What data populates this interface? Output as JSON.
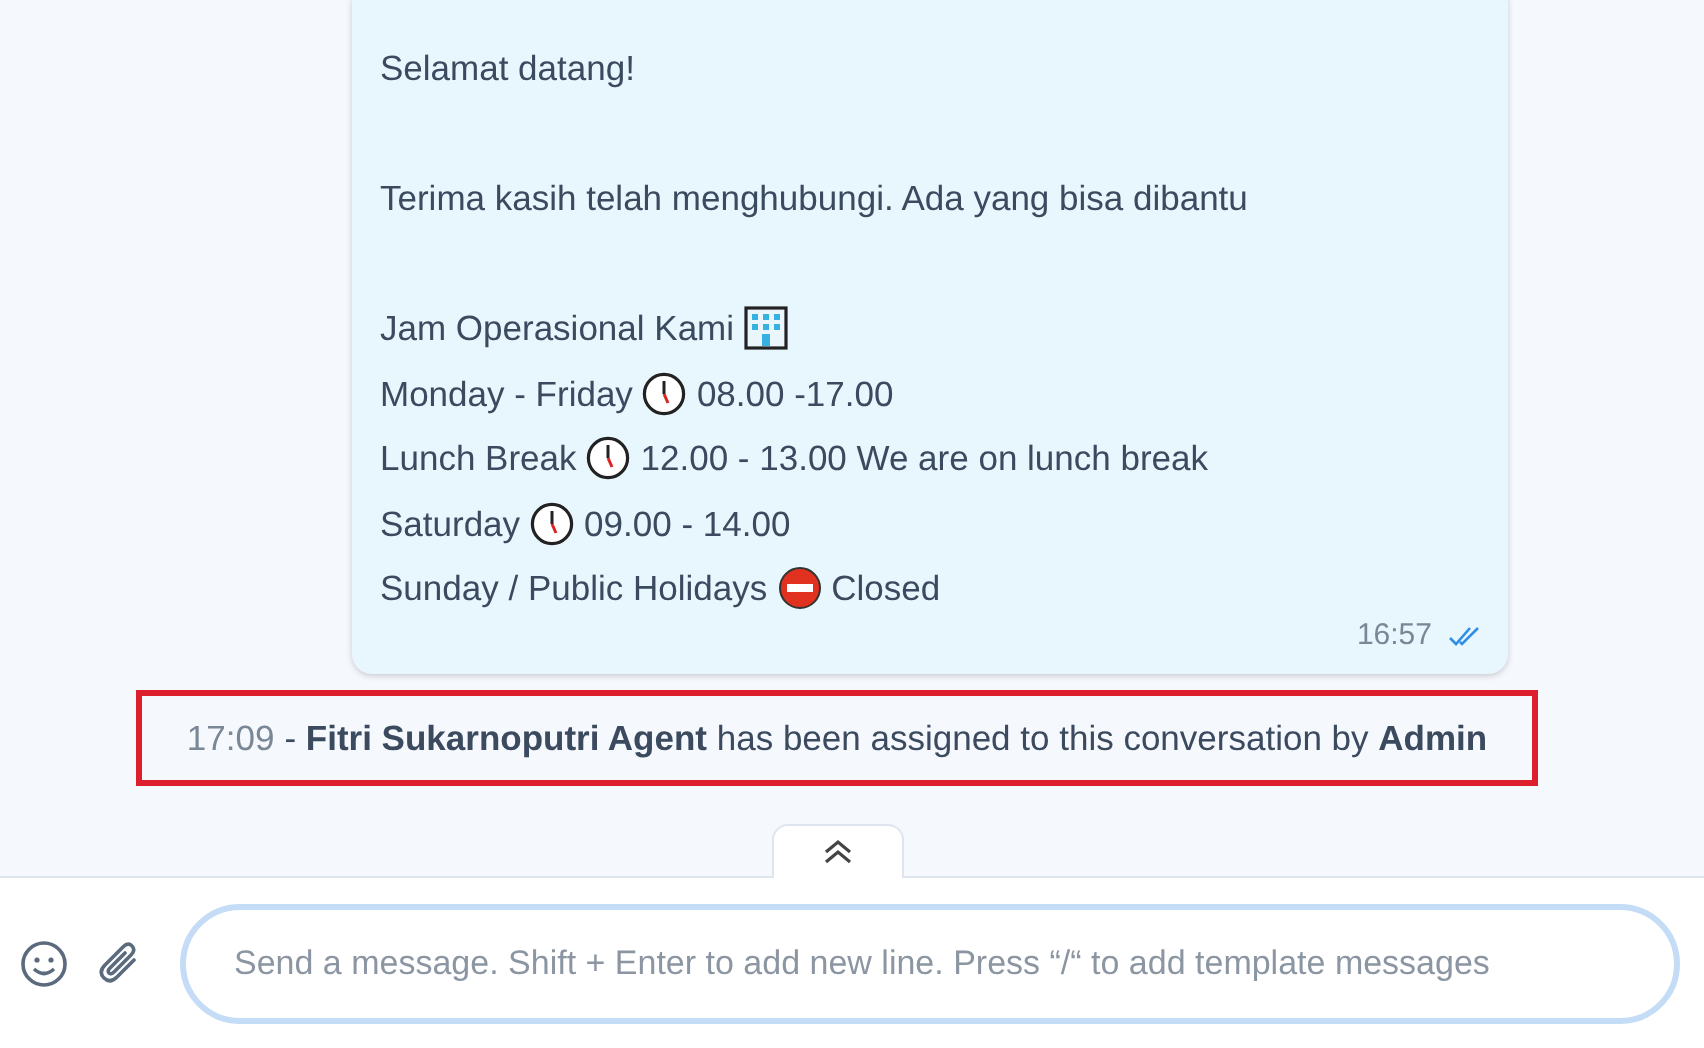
{
  "message": {
    "lines": [
      {
        "segments": [
          {
            "kind": "text",
            "text": "Selamat datang!"
          }
        ]
      },
      {
        "blank_before": true,
        "segments": [
          {
            "kind": "text",
            "text": "Terima kasih telah menghubungi. Ada yang bisa dibantu"
          }
        ]
      },
      {
        "blank_before": true,
        "segments": [
          {
            "kind": "text",
            "text": "Jam Operasional Kami"
          },
          {
            "kind": "building"
          }
        ]
      },
      {
        "segments": [
          {
            "kind": "text",
            "text": "Monday - Friday"
          },
          {
            "kind": "clock"
          },
          {
            "kind": "text",
            "text": "08.00 -17.00"
          }
        ]
      },
      {
        "segments": [
          {
            "kind": "text",
            "text": "Lunch Break"
          },
          {
            "kind": "clock"
          },
          {
            "kind": "text",
            "text": "12.00 - 13.00 We are on lunch break"
          }
        ]
      },
      {
        "segments": [
          {
            "kind": "text",
            "text": "Saturday"
          },
          {
            "kind": "clock"
          },
          {
            "kind": "text",
            "text": "09.00 - 14.00"
          }
        ]
      },
      {
        "segments": [
          {
            "kind": "text",
            "text": "Sunday / Public Holidays"
          },
          {
            "kind": "no-entry"
          },
          {
            "kind": "text",
            "text": "Closed"
          }
        ]
      }
    ],
    "time": "16:57",
    "read": true
  },
  "activity": {
    "time": "17:09",
    "text": "- **Fitri Sukarnoputri Agent** has been assigned to this conversation by **Admin**",
    "highlighted": true
  },
  "composer": {
    "placeholder": "Send a message. Shift + Enter to add new line. Press “/“ to add template messages"
  }
}
